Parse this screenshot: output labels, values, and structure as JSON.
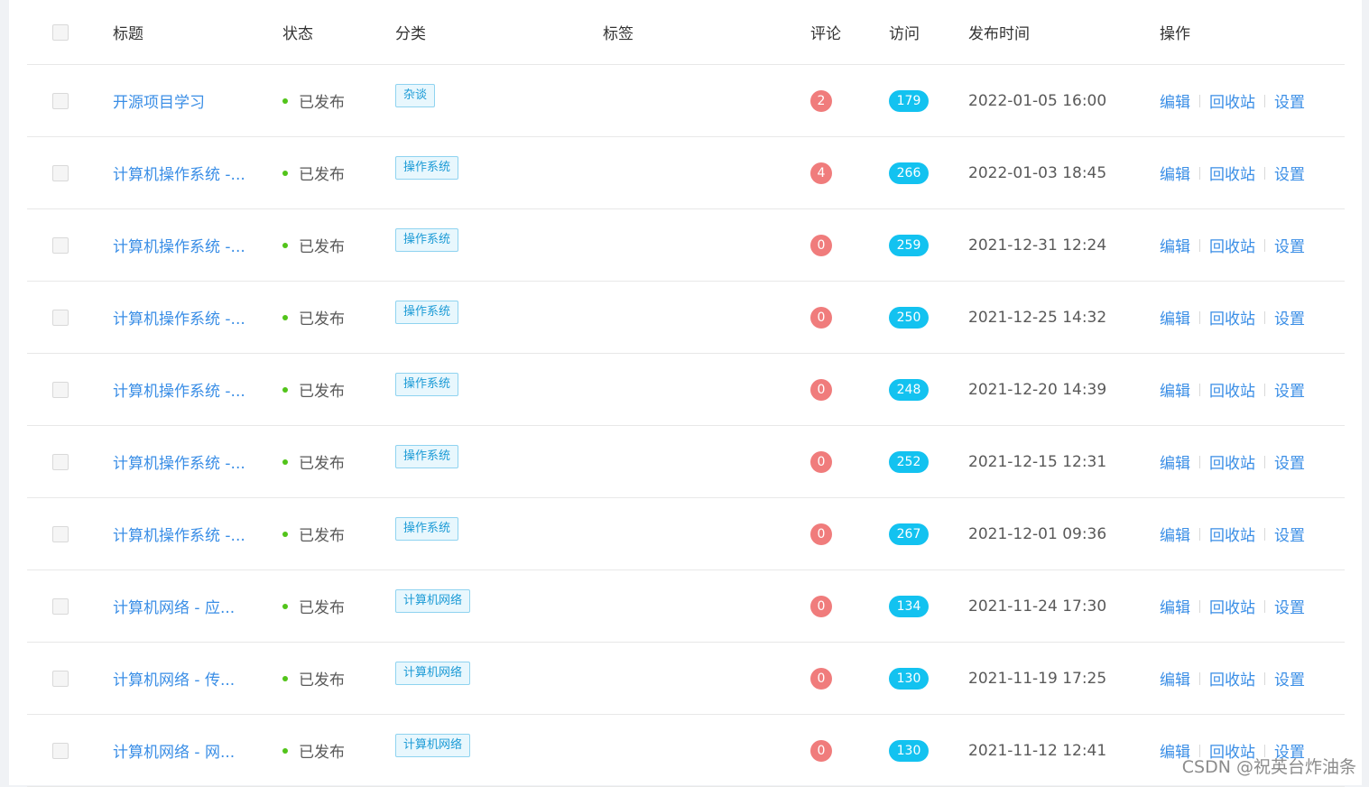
{
  "header": {
    "title": "标题",
    "status": "状态",
    "category": "分类",
    "tags": "标签",
    "comments": "评论",
    "visits": "访问",
    "publish_time": "发布时间",
    "actions": "操作"
  },
  "colors": {
    "link": "#3a8ee6",
    "status_dot": "#52c41a",
    "comment_badge": "#f07c7c",
    "visit_badge": "#13c2f0",
    "tag_border": "#8fd3f0"
  },
  "rows": [
    {
      "title": "开源项目学习",
      "status": "已发布",
      "category": "杂谈",
      "comments": "2",
      "visits": "179",
      "time": "2022-01-05 16:00"
    },
    {
      "title": "计算机操作系统 -...",
      "status": "已发布",
      "category": "操作系统",
      "comments": "4",
      "visits": "266",
      "time": "2022-01-03 18:45"
    },
    {
      "title": "计算机操作系统 -...",
      "status": "已发布",
      "category": "操作系统",
      "comments": "0",
      "visits": "259",
      "time": "2021-12-31 12:24"
    },
    {
      "title": "计算机操作系统 -...",
      "status": "已发布",
      "category": "操作系统",
      "comments": "0",
      "visits": "250",
      "time": "2021-12-25 14:32"
    },
    {
      "title": "计算机操作系统 -...",
      "status": "已发布",
      "category": "操作系统",
      "comments": "0",
      "visits": "248",
      "time": "2021-12-20 14:39"
    },
    {
      "title": "计算机操作系统 -...",
      "status": "已发布",
      "category": "操作系统",
      "comments": "0",
      "visits": "252",
      "time": "2021-12-15 12:31"
    },
    {
      "title": "计算机操作系统 -...",
      "status": "已发布",
      "category": "操作系统",
      "comments": "0",
      "visits": "267",
      "time": "2021-12-01 09:36"
    },
    {
      "title": "计算机网络 - 应...",
      "status": "已发布",
      "category": "计算机网络",
      "comments": "0",
      "visits": "134",
      "time": "2021-11-24 17:30"
    },
    {
      "title": "计算机网络 - 传...",
      "status": "已发布",
      "category": "计算机网络",
      "comments": "0",
      "visits": "130",
      "time": "2021-11-19 17:25"
    },
    {
      "title": "计算机网络 - 网...",
      "status": "已发布",
      "category": "计算机网络",
      "comments": "0",
      "visits": "130",
      "time": "2021-11-12 12:41"
    }
  ],
  "actions": {
    "edit": "编辑",
    "recycle": "回收站",
    "settings": "设置"
  },
  "watermark": "CSDN @祝英台炸油条"
}
